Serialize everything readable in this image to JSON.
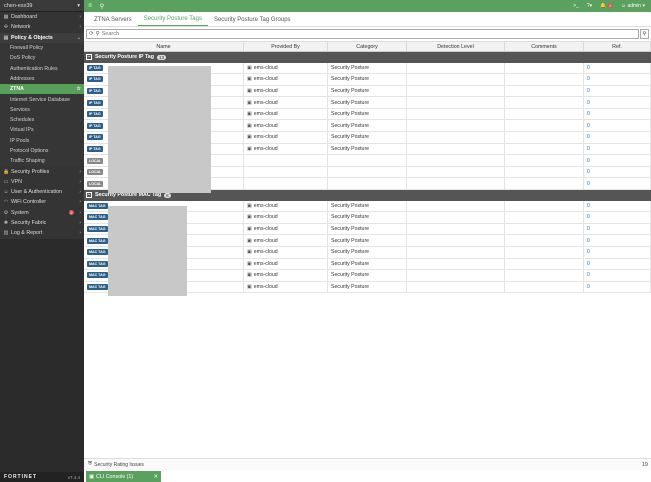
{
  "sidebar": {
    "device": "chen-esx39",
    "items": [
      {
        "label": "Dashboard",
        "icon": "dashboard-icon",
        "type": "section"
      },
      {
        "label": "Network",
        "icon": "network-icon",
        "type": "section"
      },
      {
        "label": "Policy & Objects",
        "icon": "policy-icon",
        "type": "parent"
      }
    ],
    "sub_items": [
      {
        "label": "Firewall Policy"
      },
      {
        "label": "DoS Policy"
      },
      {
        "label": "Authentication Rules"
      },
      {
        "label": "Addresses"
      },
      {
        "label": "ZTNA",
        "active": true
      },
      {
        "label": "Internet Service Database"
      },
      {
        "label": "Services"
      },
      {
        "label": "Schedules"
      },
      {
        "label": "Virtual IPs"
      },
      {
        "label": "IP Pools"
      },
      {
        "label": "Protocol Options"
      },
      {
        "label": "Traffic Shaping"
      }
    ],
    "bottom_items": [
      {
        "label": "Security Profiles",
        "icon": "lock-icon"
      },
      {
        "label": "VPN",
        "icon": "vpn-icon"
      },
      {
        "label": "User & Authentication",
        "icon": "user-icon"
      },
      {
        "label": "WiFi Controller",
        "icon": "wifi-icon"
      },
      {
        "label": "System",
        "icon": "gear-icon",
        "badge": "2"
      },
      {
        "label": "Security Fabric",
        "icon": "fabric-icon"
      },
      {
        "label": "Log & Report",
        "icon": "chart-icon"
      }
    ],
    "logo": "FORTINET",
    "version": "v7.4.4"
  },
  "topbar": {
    "notif_count": "2",
    "user": "admin"
  },
  "tabs": [
    {
      "label": "ZTNA Servers",
      "active": false
    },
    {
      "label": "Security Posture Tags",
      "active": true
    },
    {
      "label": "Security Posture Tag Groups",
      "active": false
    }
  ],
  "search": {
    "placeholder": "Search"
  },
  "table": {
    "columns": [
      "Name",
      "Provided By",
      "Category",
      "Detection Level",
      "Comments",
      "Ref."
    ],
    "groups": [
      {
        "title": "Security Posture IP Tag",
        "count": "13",
        "rows": [
          {
            "tag": "IP TAG",
            "provider": "ems-cloud",
            "category": "Security Posture",
            "ref": "0"
          },
          {
            "tag": "IP TAG",
            "provider": "ems-cloud",
            "category": "Security Posture",
            "ref": "0"
          },
          {
            "tag": "IP TAG",
            "provider": "ems-cloud",
            "category": "Security Posture",
            "ref": "0"
          },
          {
            "tag": "IP TAG",
            "provider": "ems-cloud",
            "category": "Security Posture",
            "ref": "0"
          },
          {
            "tag": "IP TAG",
            "provider": "ems-cloud",
            "category": "Security Posture",
            "ref": "0"
          },
          {
            "tag": "IP TAG",
            "provider": "ems-cloud",
            "category": "Security Posture",
            "ref": "0"
          },
          {
            "tag": "IP TAG",
            "provider": "ems-cloud",
            "category": "Security Posture",
            "ref": "0"
          },
          {
            "tag": "IP TAG",
            "provider": "ems-cloud",
            "category": "Security Posture",
            "ref": "0"
          },
          {
            "tag": "LOCAL",
            "provider": "",
            "category": "",
            "ref": "0"
          },
          {
            "tag": "LOCAL",
            "provider": "",
            "category": "",
            "ref": "0"
          },
          {
            "tag": "LOCAL",
            "provider": "",
            "category": "",
            "ref": "0"
          }
        ]
      },
      {
        "title": "Security Posture MAC Tag",
        "count": "8",
        "rows": [
          {
            "tag": "MAC TAG",
            "provider": "ems-cloud",
            "category": "Security Posture",
            "ref": "0"
          },
          {
            "tag": "MAC TAG",
            "provider": "ems-cloud",
            "category": "Security Posture",
            "ref": "0"
          },
          {
            "tag": "MAC TAG",
            "provider": "ems-cloud",
            "category": "Security Posture",
            "ref": "0"
          },
          {
            "tag": "MAC TAG",
            "provider": "ems-cloud",
            "category": "Security Posture",
            "ref": "0"
          },
          {
            "tag": "MAC TAG",
            "provider": "ems-cloud",
            "category": "Security Posture",
            "ref": "0"
          },
          {
            "tag": "MAC TAG",
            "provider": "ems-cloud",
            "category": "Security Posture",
            "ref": "0"
          },
          {
            "tag": "MAC TAG",
            "provider": "ems-cloud",
            "category": "Security Posture",
            "ref": "0"
          },
          {
            "tag": "MAC TAG",
            "provider": "ems-cloud",
            "category": "Security Posture",
            "ref": "0"
          }
        ]
      }
    ]
  },
  "status": {
    "label": "Security Rating Issues",
    "total": "19"
  },
  "cli": {
    "label": "CLI Console (1)"
  }
}
